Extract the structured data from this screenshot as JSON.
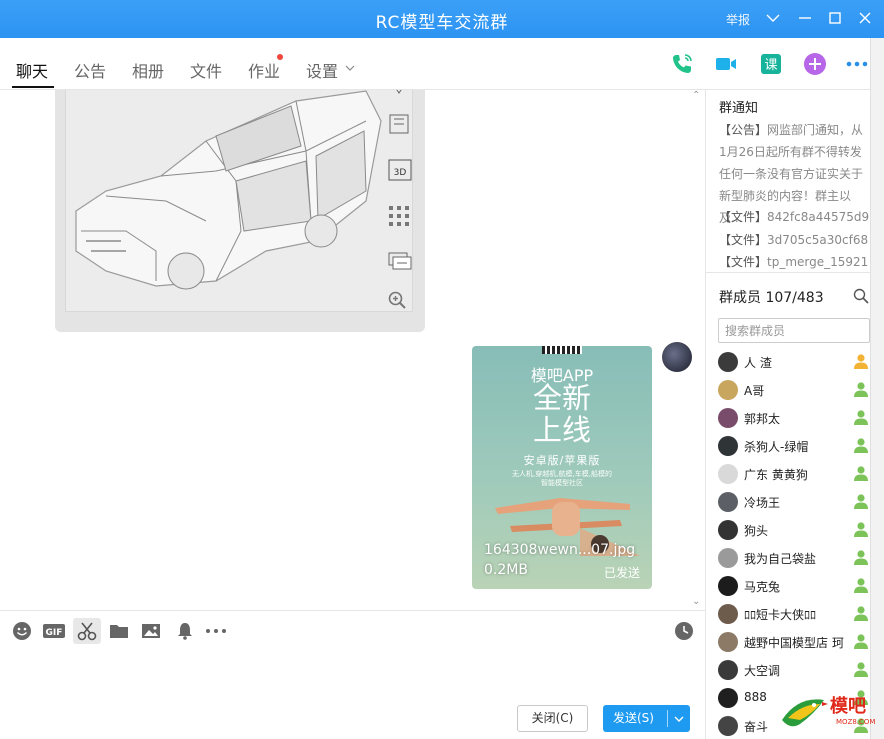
{
  "window": {
    "title": "RC模型车交流群",
    "report_label": "举报"
  },
  "tabs": [
    {
      "label": "聊天",
      "active": true
    },
    {
      "label": "公告"
    },
    {
      "label": "相册"
    },
    {
      "label": "文件"
    },
    {
      "label": "作业",
      "badge": true
    },
    {
      "label": "设置"
    }
  ],
  "toolbar_icons": [
    "phone-icon",
    "video-icon",
    "course-icon",
    "plus-app-icon",
    "more-icon"
  ],
  "chat": {
    "image_message": {
      "side_icons": [
        "face-edit-icon",
        "screenshot-icon",
        "3d-icon",
        "grid-icon",
        "chat-box-icon",
        "zoom-in-icon"
      ]
    },
    "file_message": {
      "poster": {
        "app_name": "模吧APP",
        "headline_1": "全新",
        "headline_2": "上线",
        "versions": "安卓版/苹果版",
        "description_1": "无人机,穿越机,航模,车模,船模的",
        "description_2": "智能模型社区"
      },
      "file_name": "164308wewn...07.jpg",
      "file_size": "0.2MB",
      "status": "已发送"
    }
  },
  "input": {
    "icons": [
      "emoji-icon",
      "gif-icon",
      "scissors-icon",
      "folder-icon",
      "image-icon",
      "bell-icon",
      "more-dots-icon",
      "history-clock-icon"
    ],
    "close_label": "关闭(C)",
    "send_label": "发送(S)"
  },
  "group_notice": {
    "title": "群通知",
    "announcement_tag": "【公告】",
    "announcement_text": "网监部门通知，从1月26日起所有群不得转发任何一条没有官方证实关于新型肺炎的内容！群主以及...",
    "files": [
      {
        "tag": "【文件】",
        "name": "842fc8a44575d9..."
      },
      {
        "tag": "【文件】",
        "name": "3d705c5a30cf68..."
      },
      {
        "tag": "【文件】",
        "name": "tp_merge_15921..."
      }
    ]
  },
  "members": {
    "title": "群成员 107/483",
    "search_placeholder": "搜索群成员",
    "list": [
      {
        "name": "人 渣",
        "color": "#3b3b3b"
      },
      {
        "name": "A哥",
        "color": "#c8a65e"
      },
      {
        "name": "郭邦太",
        "color": "#7a4c6b"
      },
      {
        "name": "杀狗人-绿帽",
        "color": "#2f3437"
      },
      {
        "name": "广东 黄黄狗",
        "color": "#d9d9d9"
      },
      {
        "name": "冷场王",
        "color": "#5c6066"
      },
      {
        "name": "狗头",
        "color": "#333333"
      },
      {
        "name": "我为自己袋盐",
        "color": "#9a9a9a"
      },
      {
        "name": "马克兔",
        "color": "#1c1c1c"
      },
      {
        "name": "ﾛﾛ短卡大侠ﾛﾛ",
        "color": "#6d5b4b"
      },
      {
        "name": "越野中国模型店 珂",
        "color": "#8c7a66"
      },
      {
        "name": "大空调",
        "color": "#3a3a3a"
      },
      {
        "name": "888",
        "color": "#1f1f1f"
      },
      {
        "name": "奋斗",
        "color": "#444444"
      }
    ]
  },
  "watermark": {
    "brand": "模吧",
    "domain": "MOZ8.COM"
  }
}
